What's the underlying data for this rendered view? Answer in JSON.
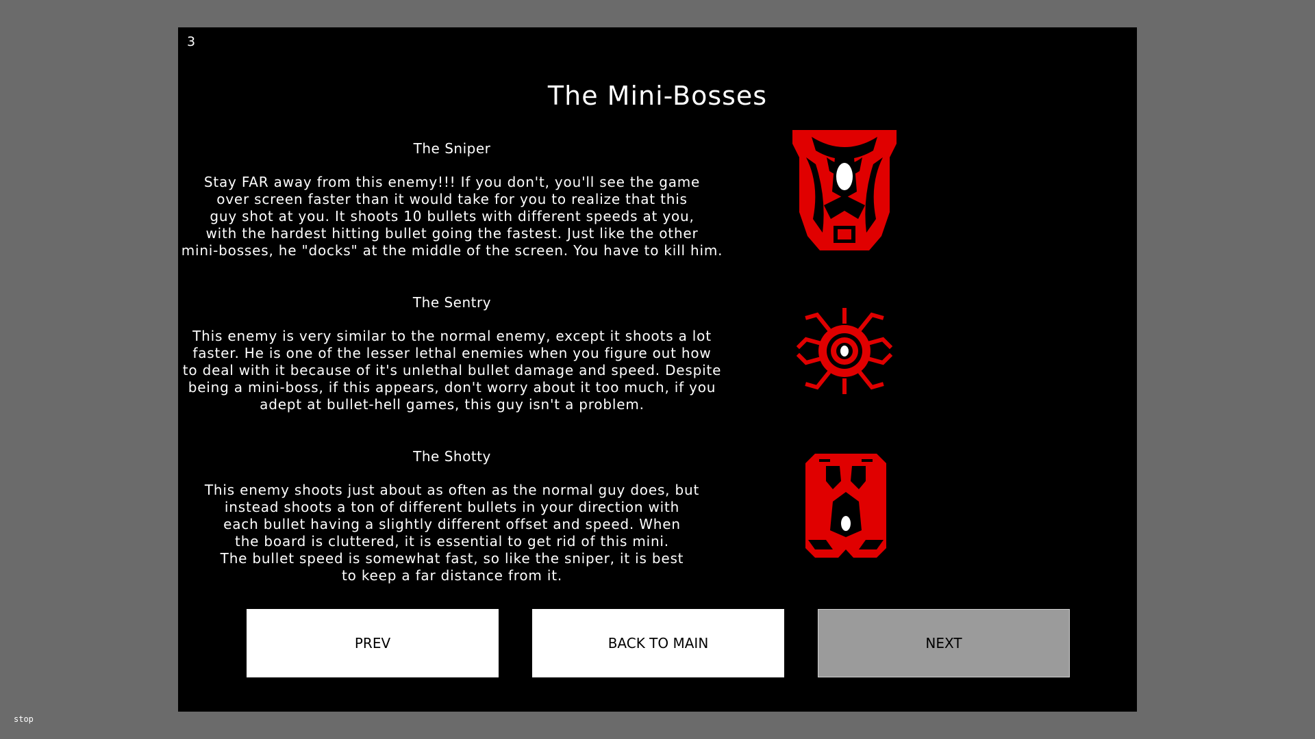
{
  "page": {
    "number": "3",
    "title": "The Mini-Bosses"
  },
  "bosses": [
    {
      "name": "The Sniper",
      "description": "Stay FAR away from this enemy!!! If you don't, you'll see the game\nover screen faster than it would take for you to realize that this\nguy shot at you. It shoots 10 bullets with different speeds at you,\nwith the hardest hitting bullet going the fastest. Just like the other\nmini-bosses, he \"docks\" at the middle of the screen. You have to kill him.",
      "sprite": "sniper-sprite-icon"
    },
    {
      "name": "The Sentry",
      "description": "This enemy is very similar to the normal enemy, except it shoots a lot\nfaster. He is one of the lesser lethal enemies when you figure out how\nto deal with it because of it's unlethal bullet damage and speed. Despite\nbeing a mini-boss, if this appears, don't worry about it too much, if you\nadept at bullet-hell games, this guy isn't a problem.",
      "sprite": "sentry-sprite-icon"
    },
    {
      "name": "The Shotty",
      "description": "This enemy shoots just about as often as the normal guy does, but\ninstead shoots a ton of different bullets in your direction with\neach bullet having a slightly different offset and speed. When\nthe board is cluttered, it is essential to get rid of this mini.\nThe bullet speed is somewhat fast, so like the sniper, it is best\nto keep a far distance from it.",
      "sprite": "shotty-sprite-icon"
    }
  ],
  "buttons": {
    "prev": "PREV",
    "back": "BACK TO MAIN",
    "next": "NEXT"
  },
  "status": {
    "text": "stop"
  },
  "colors": {
    "background": "#6b6b6b",
    "stage": "#000000",
    "enemy_red": "#e00000",
    "button": "#ffffff",
    "button_disabled": "#9b9b9b"
  }
}
